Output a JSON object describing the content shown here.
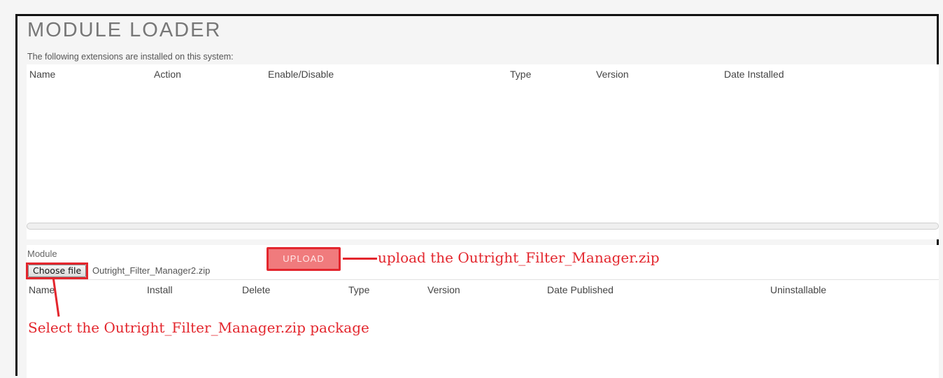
{
  "page": {
    "title": "MODULE LOADER",
    "installed_text": "The following extensions are installed on this system:"
  },
  "installed_table": {
    "columns": [
      "Name",
      "Action",
      "Enable/Disable",
      "Type",
      "Version",
      "Date Installed"
    ]
  },
  "upload": {
    "module_label": "Module",
    "choose_file_label": "Choose file",
    "selected_file": "Outright_Filter_Manager2.zip",
    "upload_label": "UPLOAD"
  },
  "package_table": {
    "columns": [
      "Name",
      "Install",
      "Delete",
      "Type",
      "Version",
      "Date Published",
      "Uninstallable"
    ]
  },
  "annotations": {
    "upload_note": "upload the Outright_Filter_Manager.zip",
    "select_note": "Select the Outright_Filter_Manager.zip package",
    "color": "#e3262d"
  }
}
